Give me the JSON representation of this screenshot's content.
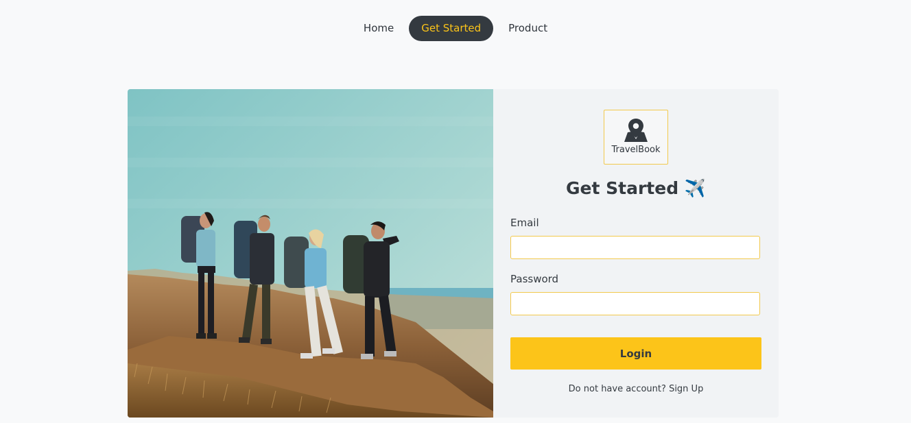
{
  "nav": {
    "items": [
      {
        "label": "Home",
        "active": false
      },
      {
        "label": "Get Started",
        "active": true
      },
      {
        "label": "Product",
        "active": false
      }
    ]
  },
  "logo": {
    "icon": "map-location-icon",
    "text": "TravelBook"
  },
  "form": {
    "title": "Get Started",
    "title_icon": "✈️",
    "email_label": "Email",
    "email_value": "",
    "password_label": "Password",
    "password_value": "",
    "login_label": "Login",
    "signup_prompt": "Do not have account?",
    "signup_link": "Sign Up"
  },
  "colors": {
    "accent": "#fcc419",
    "dark": "#343a40",
    "panel": "#f1f3f5",
    "page": "#f8f9fa"
  }
}
